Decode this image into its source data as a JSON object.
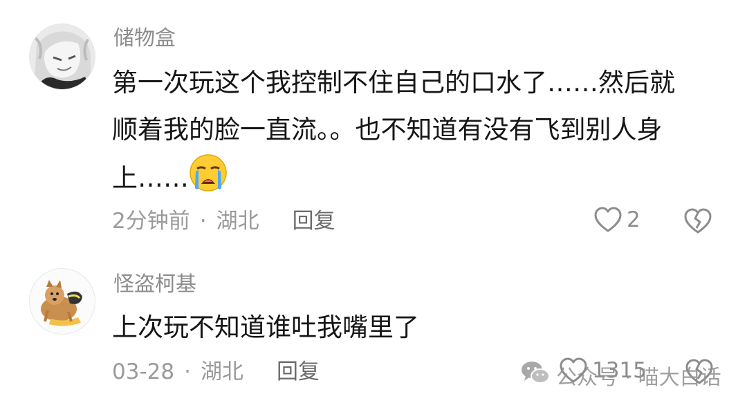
{
  "comments": [
    {
      "username": "储物盒",
      "lines": [
        "第一次玩这个我控制不住自己的口水了……然后就",
        "顺着我的脸一直流。。也不知道有没有飞到别人身",
        "上……"
      ],
      "emoji_icon": "crying-face-emoji",
      "time": "2分钟前",
      "separator": "·",
      "location": "湖北",
      "reply_label": "回复",
      "like_count": "2"
    },
    {
      "username": "怪盗柯基",
      "lines": [
        "上次玩不知道谁吐我嘴里了"
      ],
      "time": "03-28",
      "separator": "·",
      "location": "湖北",
      "reply_label": "回复",
      "like_count": "1315"
    }
  ],
  "watermark": {
    "icon": "wechat-icon",
    "text": "公众号 · 喵大白话"
  },
  "icons": {
    "like": "heart-outline-icon",
    "dislike": "broken-heart-icon"
  },
  "colors": {
    "username": "#8c8c8c",
    "body": "#161616",
    "meta": "#9a9a9a",
    "icon_stroke": "#8c8c8c"
  }
}
